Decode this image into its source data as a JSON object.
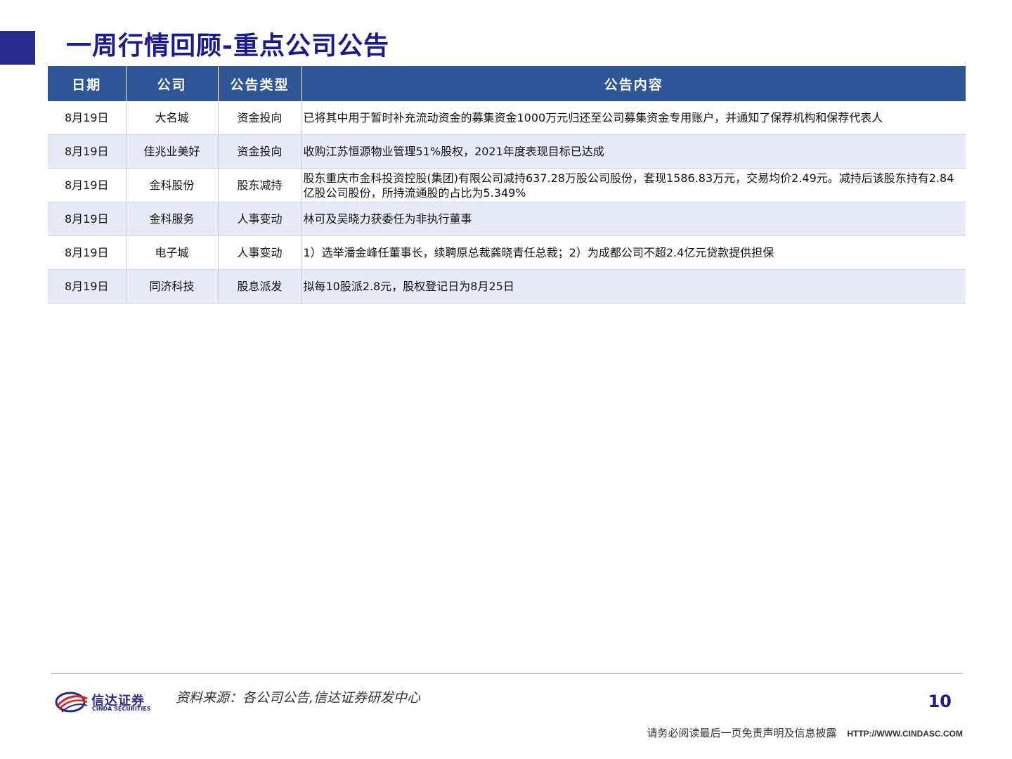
{
  "header": {
    "title": "一周行情回顾-重点公司公告"
  },
  "table": {
    "columns": [
      "日期",
      "公司",
      "公告类型",
      "公告内容"
    ],
    "rows": [
      {
        "date": "8月19日",
        "company": "大名城",
        "type": "资金投向",
        "content": "已将其中用于暂时补充流动资金的募集资金1000万元归还至公司募集资金专用账户，并通知了保荐机构和保荐代表人"
      },
      {
        "date": "8月19日",
        "company": "佳兆业美好",
        "type": "资金投向",
        "content": "收购江苏恒源物业管理51%股权，2021年度表现目标已达成"
      },
      {
        "date": "8月19日",
        "company": "金科股份",
        "type": "股东减持",
        "content": "股东重庆市金科投资控股(集团)有限公司减持637.28万股公司股份，套现1586.83万元，交易均价2.49元。减持后该股东持有2.84亿股公司股份，所持流通股的占比为5.349%"
      },
      {
        "date": "8月19日",
        "company": "金科服务",
        "type": "人事变动",
        "content": "林可及吴晓力获委任为非执行董事"
      },
      {
        "date": "8月19日",
        "company": "电子城",
        "type": "人事变动",
        "content": "1）选举潘金峰任董事长，续聘原总裁龚晓青任总裁；2）为成都公司不超2.4亿元贷款提供担保"
      },
      {
        "date": "8月19日",
        "company": "同济科技",
        "type": "股息派发",
        "content": "拟每10股派2.8元，股权登记日为8月25日"
      }
    ]
  },
  "footer": {
    "logo_cn": "信达证券",
    "logo_en": "CINDA SECURITIES",
    "source": "资料来源：各公司公告,信达证券研发中心",
    "page_number": "10",
    "disclaimer": "请务必阅读最后一页免责声明及信息披露",
    "url": "HTTP://WWW.CINDASC.COM"
  },
  "colors": {
    "header_bg": "#2f5597",
    "title": "#1a1a8c",
    "stripe": "#e6ebf5"
  }
}
